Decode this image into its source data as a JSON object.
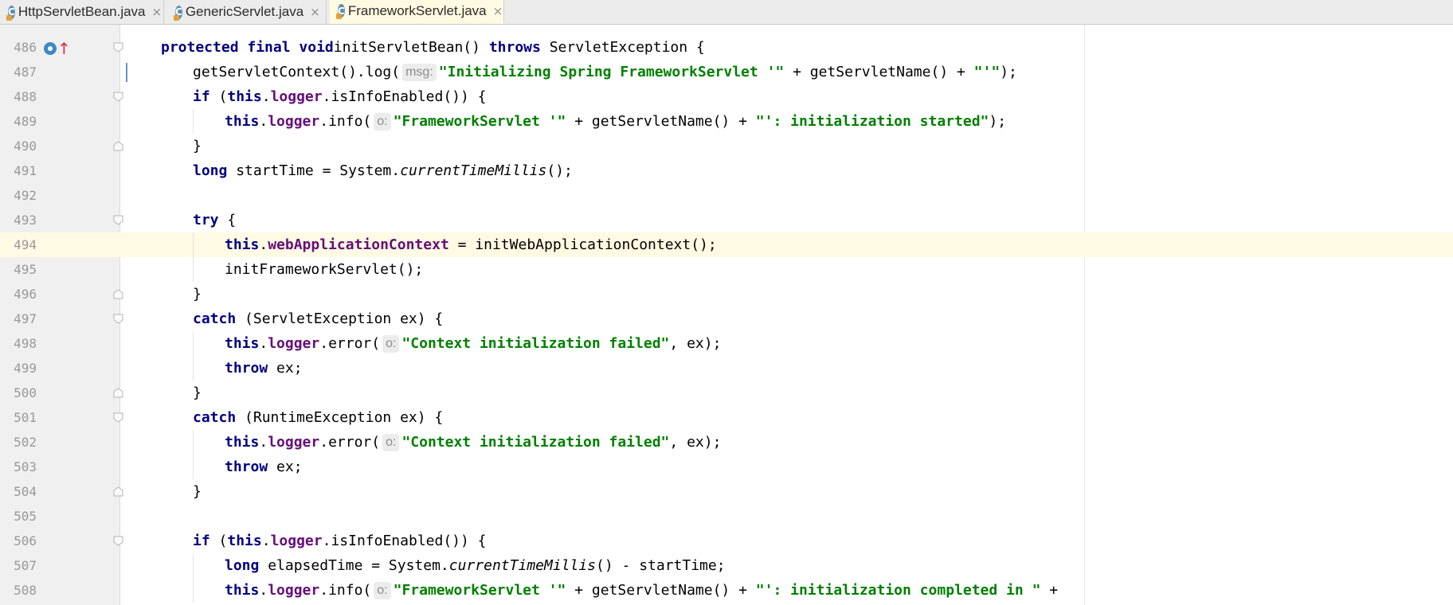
{
  "tabs": [
    {
      "label": "HttpServletBean.java",
      "active": false
    },
    {
      "label": "GenericServlet.java",
      "active": false
    },
    {
      "label": "FrameworkServlet.java",
      "active": true
    }
  ],
  "close_glyph": "×",
  "tab_icon_letter": "C",
  "current_line": "494",
  "hints": {
    "msg": "msg:",
    "o": "o:"
  },
  "lines": [
    {
      "num": "486",
      "parts": [
        [
          "kw",
          "protected final void"
        ],
        [
          "",
          "initServletBean() "
        ],
        [
          "kw",
          "throws"
        ],
        [
          "",
          " ServletException {"
        ]
      ]
    },
    {
      "num": "487",
      "parts": [
        [
          "",
          "getServletContext().log("
        ],
        [
          "hint",
          "msg:"
        ],
        [
          "str",
          "\"Initializing Spring FrameworkServlet '\""
        ],
        [
          "",
          " + getServletName() + "
        ],
        [
          "str",
          "\"'\""
        ],
        [
          "",
          ");"
        ]
      ]
    },
    {
      "num": "488",
      "parts": [
        [
          "kw",
          "if"
        ],
        [
          "",
          " ("
        ],
        [
          "kw",
          "this"
        ],
        [
          "",
          "."
        ],
        [
          "fld",
          "logger"
        ],
        [
          "",
          ".isInfoEnabled()) {"
        ]
      ]
    },
    {
      "num": "489",
      "parts": [
        [
          "kw",
          "this"
        ],
        [
          "",
          "."
        ],
        [
          "fld",
          "logger"
        ],
        [
          "",
          ".info("
        ],
        [
          "hint",
          "o:"
        ],
        [
          "str",
          "\"FrameworkServlet '\""
        ],
        [
          "",
          " + getServletName() + "
        ],
        [
          "str",
          "\"': initialization started\""
        ],
        [
          "",
          ");"
        ]
      ]
    },
    {
      "num": "490",
      "parts": [
        [
          "",
          "}"
        ]
      ]
    },
    {
      "num": "491",
      "parts": [
        [
          "kw",
          "long"
        ],
        [
          "",
          " startTime = System."
        ],
        [
          "st",
          "currentTimeMillis"
        ],
        [
          "",
          "();"
        ]
      ]
    },
    {
      "num": "492",
      "parts": []
    },
    {
      "num": "493",
      "parts": [
        [
          "kw",
          "try"
        ],
        [
          "",
          " {"
        ]
      ]
    },
    {
      "num": "494",
      "parts": [
        [
          "kw",
          "this"
        ],
        [
          "",
          "."
        ],
        [
          "fld",
          "webApplicationContext"
        ],
        [
          "",
          " = initWebApplicationContext();"
        ]
      ]
    },
    {
      "num": "495",
      "parts": [
        [
          "",
          "initFrameworkServlet();"
        ]
      ]
    },
    {
      "num": "496",
      "parts": [
        [
          "",
          "}"
        ]
      ]
    },
    {
      "num": "497",
      "parts": [
        [
          "kw",
          "catch"
        ],
        [
          "",
          " (ServletException ex) {"
        ]
      ]
    },
    {
      "num": "498",
      "parts": [
        [
          "kw",
          "this"
        ],
        [
          "",
          "."
        ],
        [
          "fld",
          "logger"
        ],
        [
          "",
          ".error("
        ],
        [
          "hint",
          "o:"
        ],
        [
          "str",
          "\"Context initialization failed\""
        ],
        [
          "",
          ", ex);"
        ]
      ]
    },
    {
      "num": "499",
      "parts": [
        [
          "kw",
          "throw"
        ],
        [
          "",
          " ex;"
        ]
      ]
    },
    {
      "num": "500",
      "parts": [
        [
          "",
          "}"
        ]
      ]
    },
    {
      "num": "501",
      "parts": [
        [
          "kw",
          "catch"
        ],
        [
          "",
          " (RuntimeException ex) {"
        ]
      ]
    },
    {
      "num": "502",
      "parts": [
        [
          "kw",
          "this"
        ],
        [
          "",
          "."
        ],
        [
          "fld",
          "logger"
        ],
        [
          "",
          ".error("
        ],
        [
          "hint",
          "o:"
        ],
        [
          "str",
          "\"Context initialization failed\""
        ],
        [
          "",
          ", ex);"
        ]
      ]
    },
    {
      "num": "503",
      "parts": [
        [
          "kw",
          "throw"
        ],
        [
          "",
          " ex;"
        ]
      ]
    },
    {
      "num": "504",
      "parts": [
        [
          "",
          "}"
        ]
      ]
    },
    {
      "num": "505",
      "parts": []
    },
    {
      "num": "506",
      "parts": [
        [
          "kw",
          "if"
        ],
        [
          "",
          " ("
        ],
        [
          "kw",
          "this"
        ],
        [
          "",
          "."
        ],
        [
          "fld",
          "logger"
        ],
        [
          "",
          ".isInfoEnabled()) {"
        ]
      ]
    },
    {
      "num": "507",
      "parts": [
        [
          "kw",
          "long"
        ],
        [
          "",
          " elapsedTime = System."
        ],
        [
          "st",
          "currentTimeMillis"
        ],
        [
          "",
          "() - startTime;"
        ]
      ]
    },
    {
      "num": "508",
      "parts": [
        [
          "kw",
          "this"
        ],
        [
          "",
          "."
        ],
        [
          "fld",
          "logger"
        ],
        [
          "",
          ".info("
        ],
        [
          "hint",
          "o:"
        ],
        [
          "str",
          "\"FrameworkServlet '\""
        ],
        [
          "",
          " + getServletName() + "
        ],
        [
          "str",
          "\"': initialization completed in \""
        ],
        [
          "",
          " +"
        ]
      ]
    }
  ],
  "colors": {
    "keyword": "#000080",
    "field": "#660e7a",
    "string": "#008000",
    "current_line_bg": "#fffae3"
  }
}
